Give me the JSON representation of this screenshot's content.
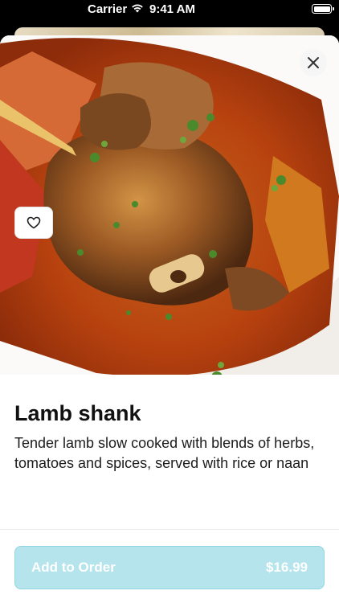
{
  "status_bar": {
    "carrier": "Carrier",
    "time": "9:41 AM"
  },
  "item": {
    "name": "Lamb shank",
    "description": "Tender lamb slow cooked with blends of herbs, tomatoes and spices, served with rice or naan",
    "image_alt": "Lamb shank dish",
    "favorite_icon": "heart-outline-icon"
  },
  "footer": {
    "add_label": "Add to Order",
    "price": "$16.99"
  },
  "colors": {
    "order_button_bg": "#b5e4ec",
    "order_button_border": "#8fd6e2"
  },
  "icons": {
    "close": "close-icon",
    "wifi": "wifi-icon",
    "battery": "battery-icon"
  }
}
